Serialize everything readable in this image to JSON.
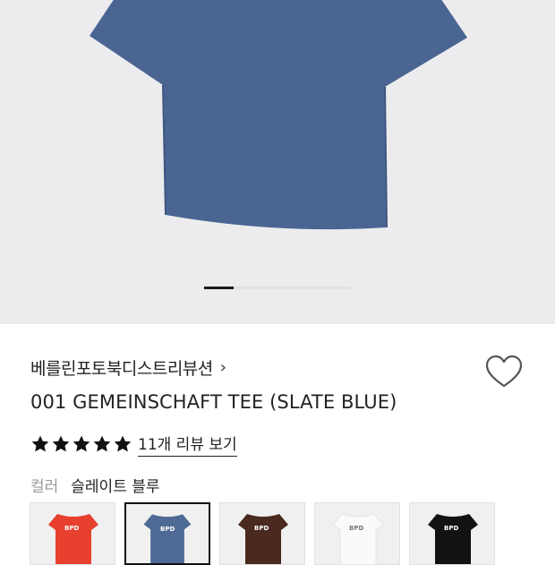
{
  "product": {
    "brand": "베를린포토북디스트리뷰션",
    "brand_chevron": "›",
    "title": "001 GEMEINSCHAFT TEE (SLATE BLUE)",
    "rating": {
      "stars": 5,
      "reviews_link": "11개 리뷰 보기"
    },
    "option": {
      "label": "컬러",
      "value": "슬레이트 블루"
    }
  },
  "carousel": {
    "main_color": "#4a6592",
    "active_index": 0
  },
  "swatches": [
    {
      "color": "#e8402e",
      "logo": "BPD"
    },
    {
      "color": "#4e6a94",
      "logo": "BPD",
      "selected": true
    },
    {
      "color": "#4a2a1e",
      "logo": "BPD"
    },
    {
      "color": "#fafafa",
      "logo": "BPD"
    },
    {
      "color": "#121212",
      "logo": "BPD"
    }
  ]
}
